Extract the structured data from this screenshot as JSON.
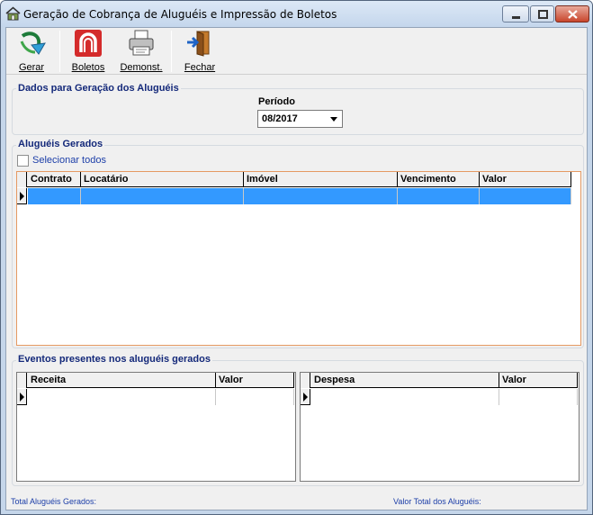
{
  "window": {
    "title": "Geração de Cobrança de Aluguéis e Impressão de Boletos"
  },
  "toolbar": {
    "gerar": "Gerar",
    "boletos": "Boletos",
    "demonst": "Demonst.",
    "fechar": "Fechar"
  },
  "dados": {
    "title": "Dados para Geração dos Aluguéis",
    "periodo_label": "Período",
    "periodo_value": "08/2017"
  },
  "alugueis": {
    "title": "Aluguéis Gerados",
    "select_all": "Selecionar todos",
    "columns": [
      "Contrato",
      "Locatário",
      "Imóvel",
      "Vencimento",
      "Valor"
    ]
  },
  "eventos": {
    "title": "Eventos presentes nos aluguéis gerados",
    "receita_columns": [
      "Receita",
      "Valor"
    ],
    "despesa_columns": [
      "Despesa",
      "Valor"
    ]
  },
  "footer": {
    "total_label": "Total Aluguéis Gerados:",
    "valor_label": "Valor Total dos Aluguéis:"
  },
  "colors": {
    "selection": "#3399ff",
    "group_title": "#14297a",
    "grid_border_active": "#e59a63"
  }
}
